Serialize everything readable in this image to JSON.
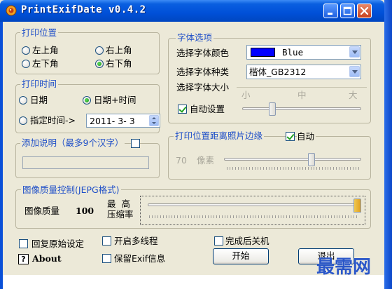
{
  "window": {
    "title": "PrintExifDate v0.4.2"
  },
  "print_position": {
    "title": "打印位置",
    "options": [
      "左上角",
      "右上角",
      "左下角",
      "右下角"
    ],
    "selected": "右下角"
  },
  "print_time": {
    "title": "打印时间",
    "date_label": "日期",
    "datetime_label": "日期+时间",
    "specify_label": "指定时间->",
    "date_value": "2011- 3- 3",
    "selected": "日期+时间"
  },
  "add_note": {
    "title": "添加说明（最多9个汉字）",
    "value": ""
  },
  "font_options": {
    "title": "字体选项",
    "color_label": "选择字体颜色",
    "color_value": "Blue",
    "swatch_color": "#0000FF",
    "font_label": "选择字体种类",
    "font_value": "楷体_GB2312",
    "size_title": "选择字体大小",
    "size_small": "小",
    "size_medium": "中",
    "size_large": "大",
    "auto_label": "自动设置",
    "auto_checked": true,
    "size_slider_fraction": 0.18
  },
  "margin": {
    "title": "打印位置距离照片边缘",
    "auto_label": "自动",
    "auto_checked": true,
    "value": "70",
    "unit": "像素",
    "slider_fraction": 0.7
  },
  "quality": {
    "title": "图像质量控制(JEPG格式)",
    "label": "图像质量",
    "value": "100",
    "max_label_top": "最  高",
    "max_label_bottom": "压缩率",
    "slider_fraction": 1.0
  },
  "bottom": {
    "restore_label": "回复原始设定",
    "multithread_label": "开启多线程",
    "shutdown_label": "完成后关机",
    "about_label": "About",
    "about_icon_text": "?",
    "keep_exif_label": "保留Exif信息",
    "start_label": "开始",
    "exit_label": "退出"
  },
  "watermark": "最需网",
  "colors": {
    "accent": "#2050C8",
    "titlebar": "#0054E3"
  },
  "icons": {
    "app": "camera-icon",
    "minimize": "minimize-icon",
    "maximize": "maximize-icon",
    "close": "close-icon"
  }
}
